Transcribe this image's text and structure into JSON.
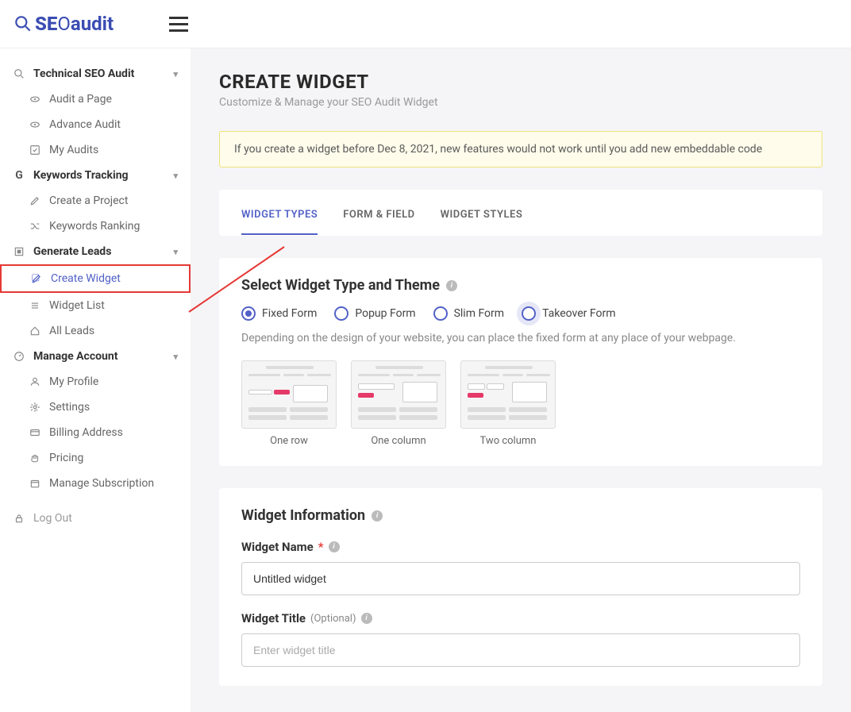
{
  "logo": {
    "text": "SEOaudit"
  },
  "sidebar": {
    "groups": [
      {
        "label": "Technical SEO Audit",
        "items": [
          "Audit a Page",
          "Advance Audit",
          "My Audits"
        ]
      },
      {
        "label": "Keywords Tracking",
        "items": [
          "Create a Project",
          "Keywords Ranking"
        ]
      },
      {
        "label": "Generate Leads",
        "items": [
          "Create Widget",
          "Widget List",
          "All Leads"
        ]
      },
      {
        "label": "Manage Account",
        "items": [
          "My Profile",
          "Settings",
          "Billing Address",
          "Pricing",
          "Manage Subscription"
        ]
      }
    ],
    "logout": "Log Out"
  },
  "page": {
    "title": "CREATE WIDGET",
    "subtitle": "Customize & Manage your SEO Audit Widget"
  },
  "alert": "If you create a widget before Dec 8, 2021, new features would not work until you add new embeddable code",
  "tabs": [
    "WIDGET TYPES",
    "FORM & FIELD",
    "WIDGET STYLES"
  ],
  "widget_types": {
    "heading": "Select Widget Type and Theme",
    "options": [
      "Fixed Form",
      "Popup Form",
      "Slim Form",
      "Takeover Form"
    ],
    "description": "Depending on the design of your website, you can place the fixed form at any place of your webpage.",
    "themes": [
      "One row",
      "One column",
      "Two column"
    ]
  },
  "widget_info": {
    "heading": "Widget Information",
    "name_label": "Widget Name",
    "name_value": "Untitled widget",
    "title_label": "Widget Title",
    "title_optional": "(Optional)",
    "title_placeholder": "Enter widget title"
  }
}
